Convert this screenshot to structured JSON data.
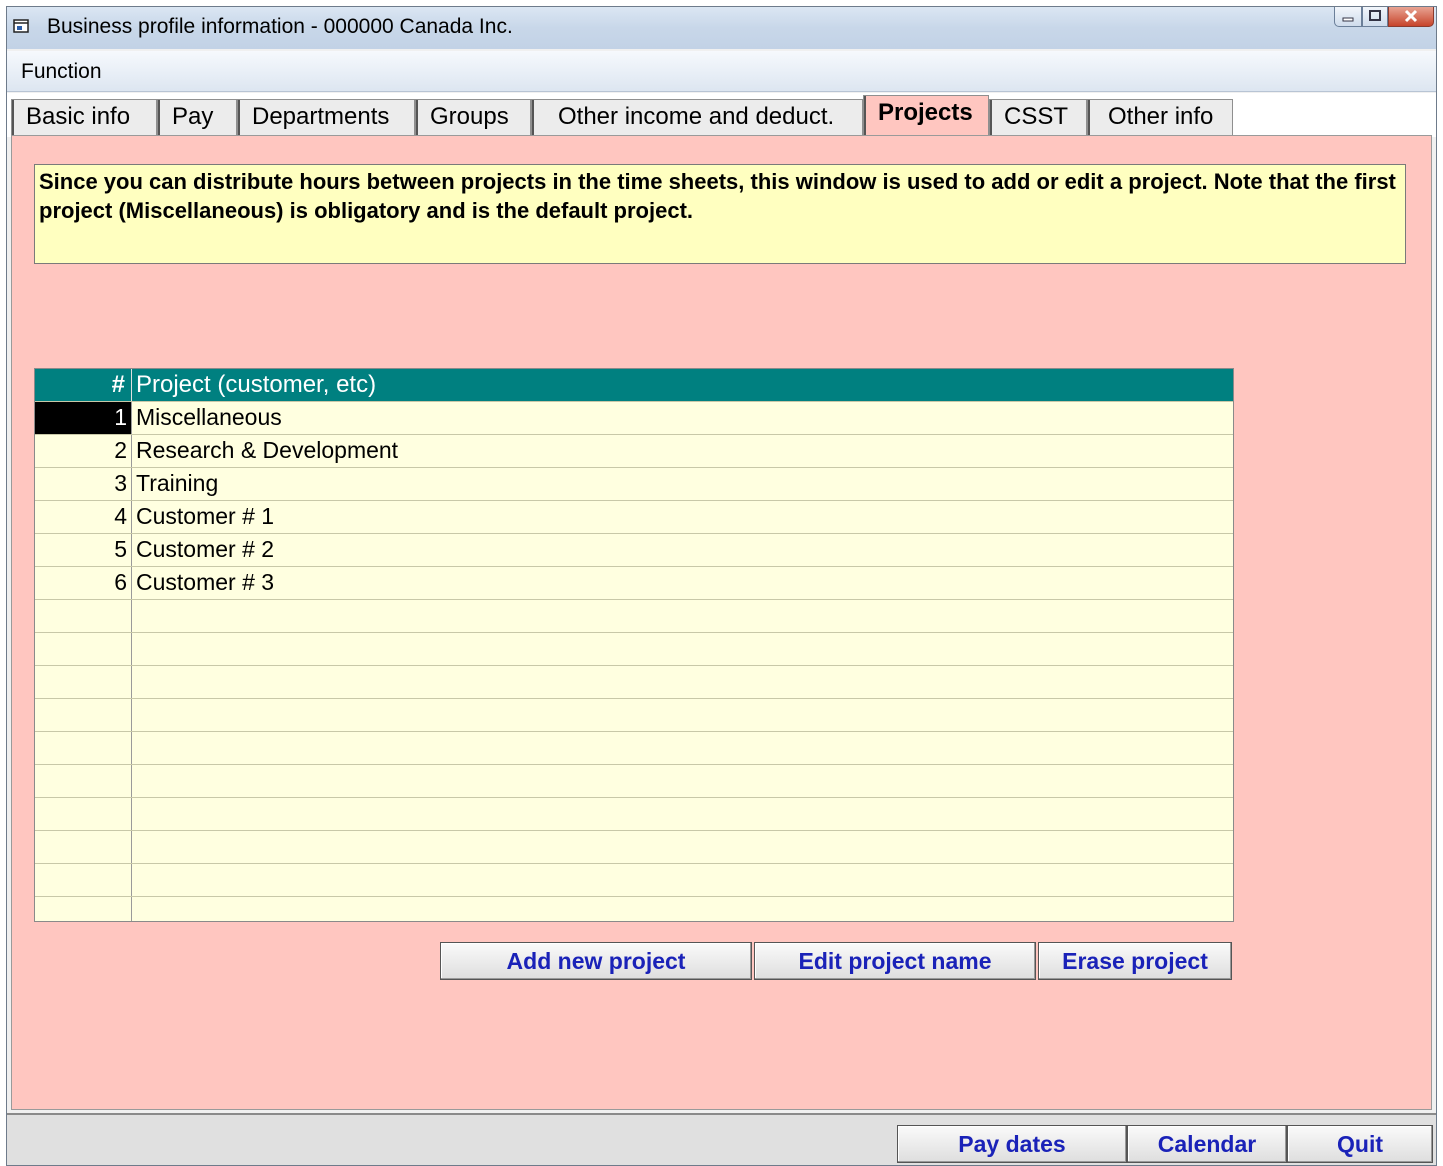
{
  "window": {
    "title": "Business profile information - 000000 Canada Inc.",
    "controls": {
      "minimize": "–",
      "maximize": "□",
      "close": "X"
    }
  },
  "menu": {
    "items": [
      "Function"
    ]
  },
  "tabs": [
    {
      "label": "Basic info"
    },
    {
      "label": "Pay"
    },
    {
      "label": "Departments"
    },
    {
      "label": "Groups"
    },
    {
      "label": "Other income and deduct."
    },
    {
      "label": "Projects"
    },
    {
      "label": "CSST"
    },
    {
      "label": "Other info"
    }
  ],
  "active_tab": "Projects",
  "note": "Since you can distribute hours between projects in the time sheets, this window is used to add or edit a project. Note that the first project (Miscellaneous) is obligatory and is the default project.",
  "grid": {
    "columns": [
      "#",
      "Project (customer, etc)"
    ],
    "rows": [
      {
        "num": "1",
        "name": "Miscellaneous"
      },
      {
        "num": "2",
        "name": "Research & Development"
      },
      {
        "num": "3",
        "name": "Training"
      },
      {
        "num": "4",
        "name": "Customer # 1"
      },
      {
        "num": "5",
        "name": "Customer # 2"
      },
      {
        "num": "6",
        "name": "Customer # 3"
      },
      {
        "num": "",
        "name": ""
      },
      {
        "num": "",
        "name": ""
      },
      {
        "num": "",
        "name": ""
      },
      {
        "num": "",
        "name": ""
      },
      {
        "num": "",
        "name": ""
      },
      {
        "num": "",
        "name": ""
      },
      {
        "num": "",
        "name": ""
      },
      {
        "num": "",
        "name": ""
      },
      {
        "num": "",
        "name": ""
      },
      {
        "num": "",
        "name": ""
      }
    ]
  },
  "actions": {
    "add": "Add new project",
    "edit": "Edit project name",
    "erase": "Erase project"
  },
  "footer": {
    "pay_dates": "Pay dates",
    "calendar": "Calendar",
    "quit": "Quit"
  },
  "colors": {
    "panel_bg": "#ffc6c0",
    "note_bg": "#ffffc0",
    "grid_header": "#008080",
    "grid_bg": "#ffffe0",
    "button_text": "#1a22b8"
  }
}
